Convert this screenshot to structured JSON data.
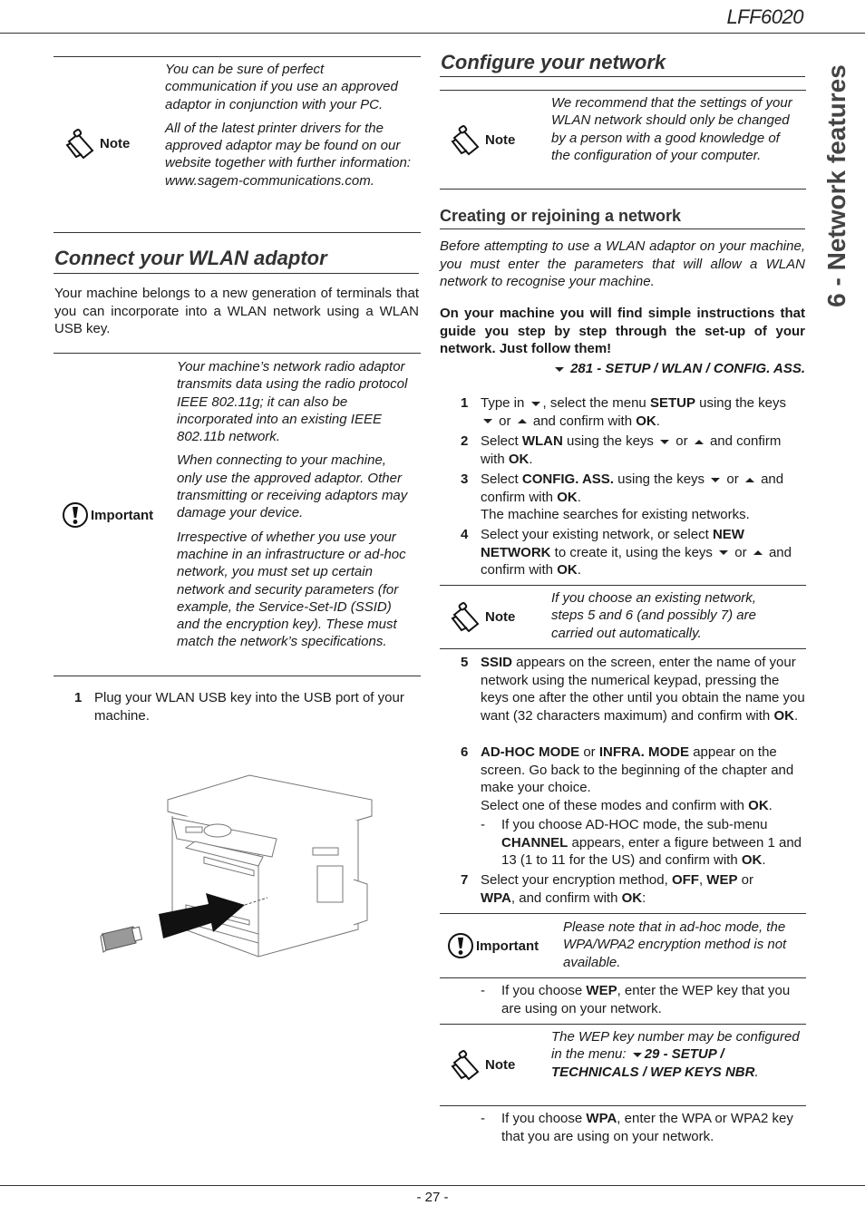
{
  "header": {
    "model": "LFF6020"
  },
  "side_tab": {
    "chapter": "6 - Network features"
  },
  "left_column": {
    "note1": {
      "label": "Note",
      "icon": "clipboard-note-icon",
      "paragraphs": [
        "You can be sure of perfect communication if you use an approved adaptor in conjunction with your PC.",
        "All of the latest printer drivers for the approved adaptor may be found on our website together with further information: www.sagem-communications.com."
      ]
    },
    "section_title": "Connect your WLAN adaptor",
    "intro": "Your machine belongs to a new generation of terminals that you can incorporate into a WLAN network using a WLAN USB key.",
    "important1": {
      "label": "Important",
      "icon": "exclamation-circle-icon",
      "paragraphs": [
        "Your machine’s network radio adaptor transmits data using the radio protocol IEEE 802.11g; it can also be incorporated into an existing IEEE 802.11b network.",
        "When connecting to your machine, only use the approved adaptor. Other transmitting or receiving adaptors may damage your device.",
        "Irrespective of whether you use your machine in an infrastructure or ad-hoc network, you must set up certain network and security parameters (for example, the Service-Set-ID (SSID) and the encryption key). These must match the network’s specifications."
      ]
    },
    "step1": {
      "num": "1",
      "text": "Plug your WLAN USB key into the USB port of your machine."
    },
    "illustration": {
      "alt": "Printer with WLAN USB key being inserted into USB port",
      "icon": "printer-usb-illustration"
    }
  },
  "right_column": {
    "section_title": "Configure your network",
    "note1": {
      "label": "Note",
      "icon": "clipboard-note-icon",
      "text": "We recommend that the settings of your WLAN network should only be changed by a person with a good knowledge of the configuration of your computer."
    },
    "subsection_title": "Creating or rejoining a network",
    "intro_italic": "Before attempting to use a WLAN adaptor on your machine, you must enter the parameters that will allow a WLAN network to recognise your machine.",
    "intro_bold": "On your machine you will find simple instructions that guide you step by step through the set-up of your network. Just follow them!",
    "menu_path": "281 - SETUP / WLAN / CONFIG. ASS.",
    "steps": [
      {
        "num": "1",
        "t1": "Type in ",
        "t2": ", select the menu ",
        "b1": "SETUP",
        "t3": " using the keys",
        "t4": " or ",
        "t5": " and confirm with ",
        "b2": "OK",
        "t6": "."
      },
      {
        "num": "2",
        "t1": "Select ",
        "b1": "WLAN",
        "t2": " using the keys ",
        "t3": " or ",
        "t4": " and confirm with ",
        "b2": "OK",
        "t5": "."
      },
      {
        "num": "3",
        "t1": "Select ",
        "b1": "CONFIG. ASS.",
        "t2": " using the keys ",
        "t3": " or ",
        "t4": " and confirm with ",
        "b2": "OK",
        "t5": ".",
        "t6": "The machine searches for existing networks."
      },
      {
        "num": "4",
        "t1": "Select your existing network, or select ",
        "b1": "NEW NETWORK",
        "t2": " to create it, using the keys ",
        "t3": " or ",
        "t4": " and confirm with ",
        "b2": "OK",
        "t5": "."
      },
      {
        "num": "5",
        "b1": "SSID",
        "t1": " appears on the screen, enter the name of your network using the numerical keypad, pressing the keys one after the other until you obtain the name you want (32 characters maximum) and confirm with ",
        "b2": "OK",
        "t2": "."
      },
      {
        "num": "6",
        "b1": "AD-HOC MODE",
        "t1": " or ",
        "b2": "INFRA. MODE",
        "t2": " appear on the screen. Go back to the beginning of the chapter and make your choice.",
        "t3": "Select one of these modes and confirm with ",
        "b3": "OK",
        "t4": "."
      },
      {
        "num": "7",
        "t1": "Select your encryption method, ",
        "b1": "OFF",
        "t2": ", ",
        "b2": "WEP",
        "t3": " or ",
        "b3": "WPA",
        "t4": ", and confirm with ",
        "b4": "OK",
        "t5": ":"
      }
    ],
    "note2": {
      "label": "Note",
      "icon": "clipboard-note-icon",
      "text": "If you choose an existing network, steps 5 and 6 (and possibly 7) are carried out automatically."
    },
    "sub_adhoc": {
      "dash": "-",
      "t1": "If you choose AD-HOC mode, the sub-menu ",
      "b1": "CHANNEL",
      "t2": " appears, enter a figure between 1 and 13 (1 to 11 for the US) and confirm with ",
      "b2": "OK",
      "t3": "."
    },
    "important1": {
      "label": "Important",
      "icon": "exclamation-circle-icon",
      "text": "Please note that in ad-hoc mode, the WPA/WPA2 encryption method is not available."
    },
    "sub_wep": {
      "dash": "-",
      "t1": "If you choose ",
      "b1": "WEP",
      "t2": ", enter the WEP key that you are using on your network."
    },
    "note3": {
      "label": "Note",
      "icon": "clipboard-note-icon",
      "t1": "The WEP key number may be configured in the menu: ",
      "b1": "29 - SETUP / TECHNICALS / WEP KEYS NBR",
      "t2": "."
    },
    "sub_wpa": {
      "dash": "-",
      "t1": "If you choose ",
      "b1": "WPA",
      "t2": ", enter the WPA or WPA2 key that you are using on your network."
    }
  },
  "footer": {
    "page_number": "- 27 -"
  }
}
